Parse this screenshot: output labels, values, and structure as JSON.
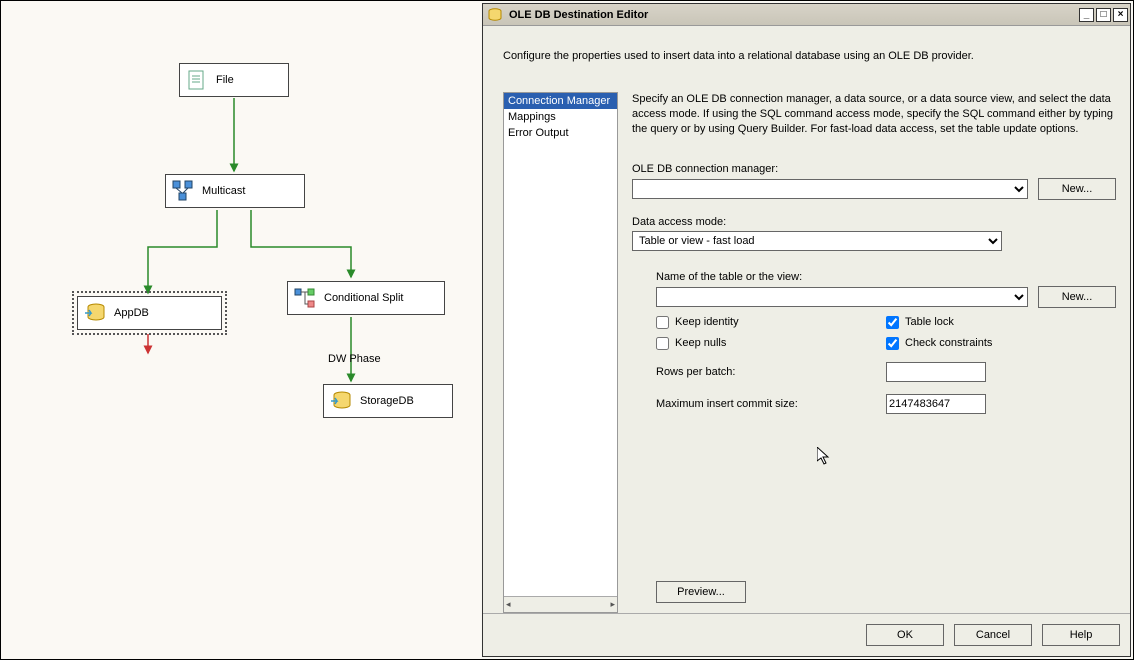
{
  "canvas": {
    "nodes": {
      "file": {
        "label": "File"
      },
      "multicast": {
        "label": "Multicast"
      },
      "appdb": {
        "label": "AppDB"
      },
      "condsplit": {
        "label": "Conditional Split"
      },
      "condsplit_out_label": "DW Phase",
      "storagedb": {
        "label": "StorageDB"
      }
    }
  },
  "dialog": {
    "title": "OLE DB Destination Editor",
    "intro": "Configure the properties used to insert data into a relational database using an OLE DB provider.",
    "nav": {
      "items": [
        "Connection Manager",
        "Mappings",
        "Error Output"
      ],
      "selected_index": 0
    },
    "panel_desc": "Specify an OLE DB connection manager, a data source, or a data source view, and select the data access mode. If using the SQL command access mode, specify the SQL command either by typing the query or by using Query Builder. For fast-load data access, set the table update options.",
    "labels": {
      "conn_mgr": "OLE DB connection manager:",
      "new_btn": "New...",
      "access_mode": "Data access mode:",
      "table_name": "Name of the table or the view:",
      "keep_identity": "Keep identity",
      "table_lock": "Table lock",
      "keep_nulls": "Keep nulls",
      "check_constraints": "Check constraints",
      "rows_per_batch": "Rows per batch:",
      "max_commit": "Maximum insert commit size:",
      "preview": "Preview...",
      "ok": "OK",
      "cancel": "Cancel",
      "help": "Help"
    },
    "values": {
      "conn_mgr": "",
      "access_mode": "Table or view - fast load",
      "table_name": "",
      "keep_identity": false,
      "table_lock": true,
      "keep_nulls": false,
      "check_constraints": true,
      "rows_per_batch": "",
      "max_commit": "2147483647"
    }
  }
}
